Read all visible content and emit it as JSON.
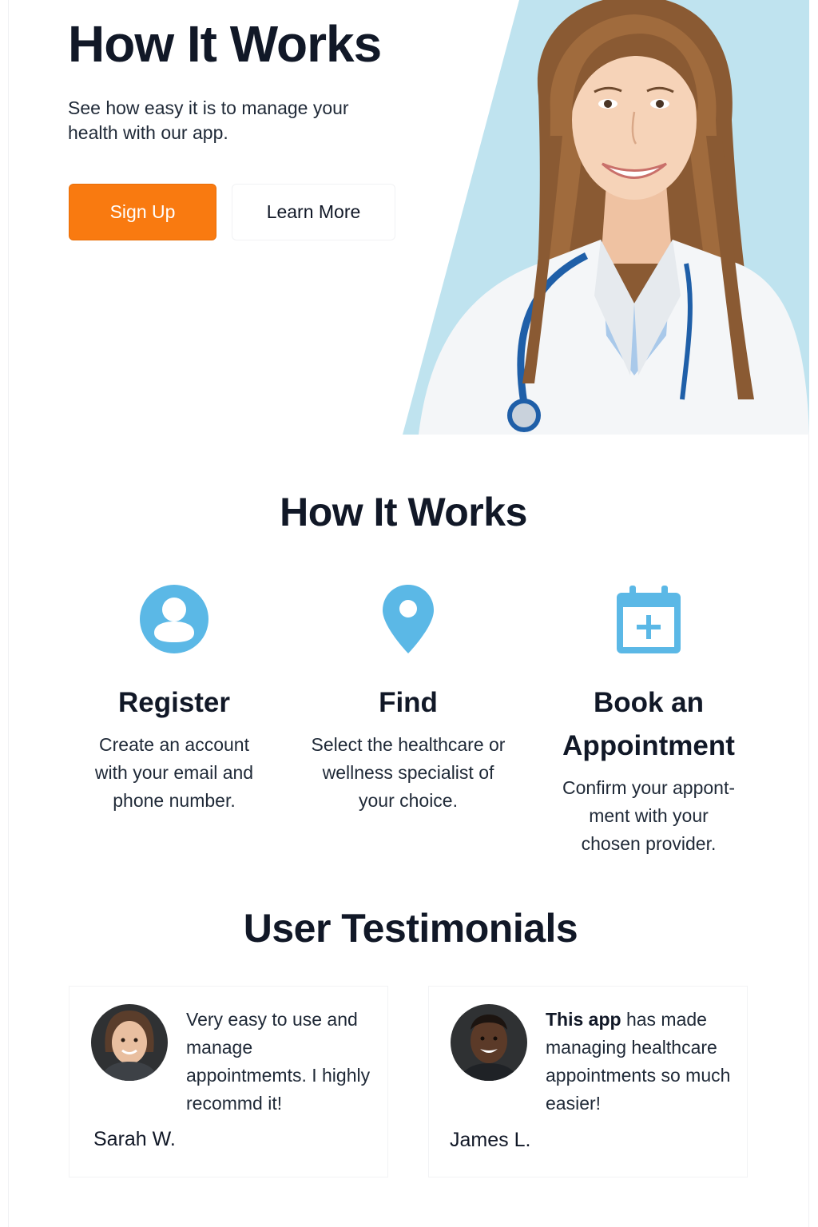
{
  "hero": {
    "title": "How It Works",
    "subtitle": "See how easy it is to manage your health with our app.",
    "signup_label": "Sign Up",
    "learn_more_label": "Learn More"
  },
  "how_it_works": {
    "title": "How It Works",
    "steps": [
      {
        "icon": "user-icon",
        "title": "Register",
        "text": "Create an account with your email and phone number."
      },
      {
        "icon": "location-pin-icon",
        "title": "Find",
        "text": "Select the healthcare or wellness specialist of your choice."
      },
      {
        "icon": "calendar-plus-icon",
        "title": "Book an Appointment",
        "text": "Confirm your appont-ment with your chosen provider."
      }
    ]
  },
  "testimonials": {
    "title": "User Testimonials",
    "items": [
      {
        "quote": "Very easy to use and manage appointmemts. I highly recommd it!",
        "author": "Sarah W."
      },
      {
        "quote_bold": "This app",
        "quote_rest": " has made managing healthcare appointments so much easier!",
        "author": "James L."
      }
    ]
  },
  "colors": {
    "accent_orange": "#f97a10",
    "icon_blue": "#5bb8e6",
    "hero_bg_blue": "#bfe3ef",
    "text_dark": "#111827"
  }
}
